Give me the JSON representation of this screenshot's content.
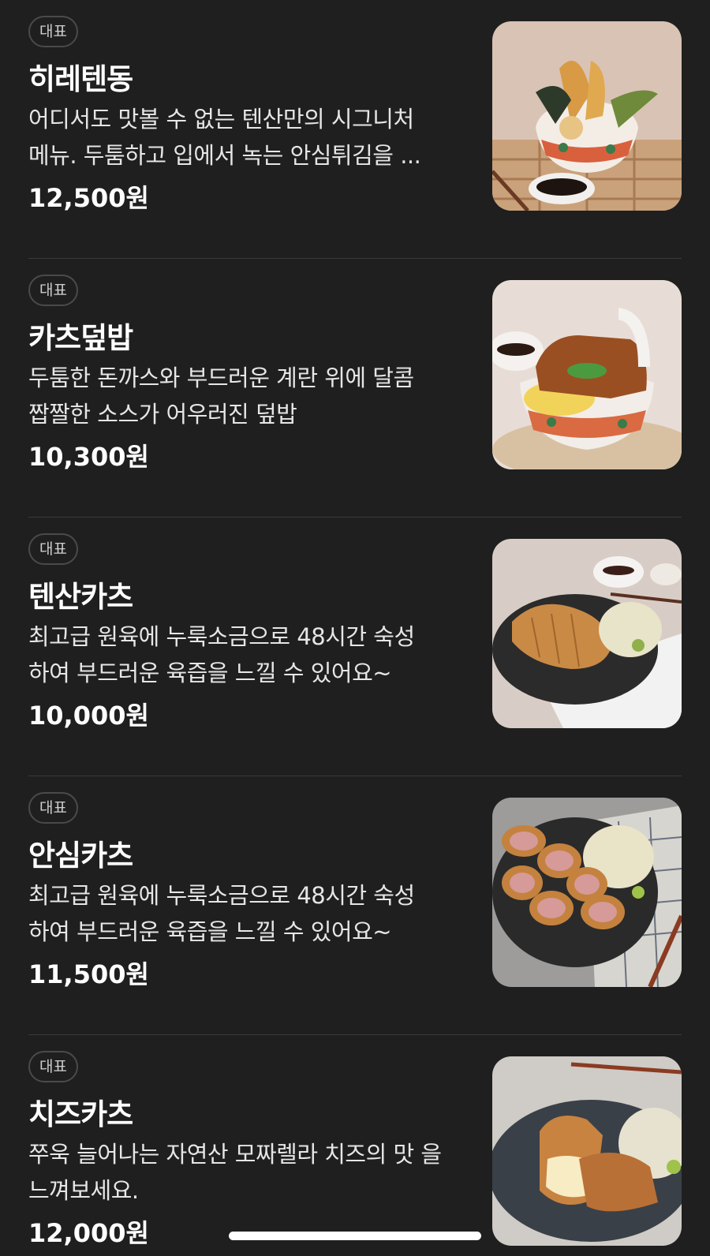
{
  "menu": {
    "items": [
      {
        "badge": "대표",
        "name": "히레텐동",
        "description": "어디서도 맛볼 수 없는 텐산만의 시그니처 메뉴. 두툼하고 입에서 녹는 안심튀김을 ...",
        "price": "12,500원",
        "image": "tendon-bowl-photo"
      },
      {
        "badge": "대표",
        "name": "카츠덮밥",
        "description": "두툼한 돈까스와 부드러운 계란 위에 달콤 짭짤한 소스가 어우러진 덮밥",
        "price": "10,300원",
        "image": "katsudon-bowl-photo"
      },
      {
        "badge": "대표",
        "name": "텐산카츠",
        "description": "최고급 원육에 누룩소금으로 48시간 숙성 하여 부드러운 육즙을 느낄 수 있어요~",
        "price": "10,000원",
        "image": "pork-cutlet-plate-photo"
      },
      {
        "badge": "대표",
        "name": "안심카츠",
        "description": "최고급 원육에 누룩소금으로 48시간 숙성 하여 부드러운 육즙을 느낄 수 있어요~",
        "price": "11,500원",
        "image": "tenderloin-cutlet-plate-photo"
      },
      {
        "badge": "대표",
        "name": "치즈카츠",
        "description": "쭈욱 늘어나는 자연산 모짜렐라 치즈의 맛 을 느껴보세요.",
        "price": "12,000원",
        "image": "cheese-cutlet-plate-photo"
      }
    ]
  }
}
